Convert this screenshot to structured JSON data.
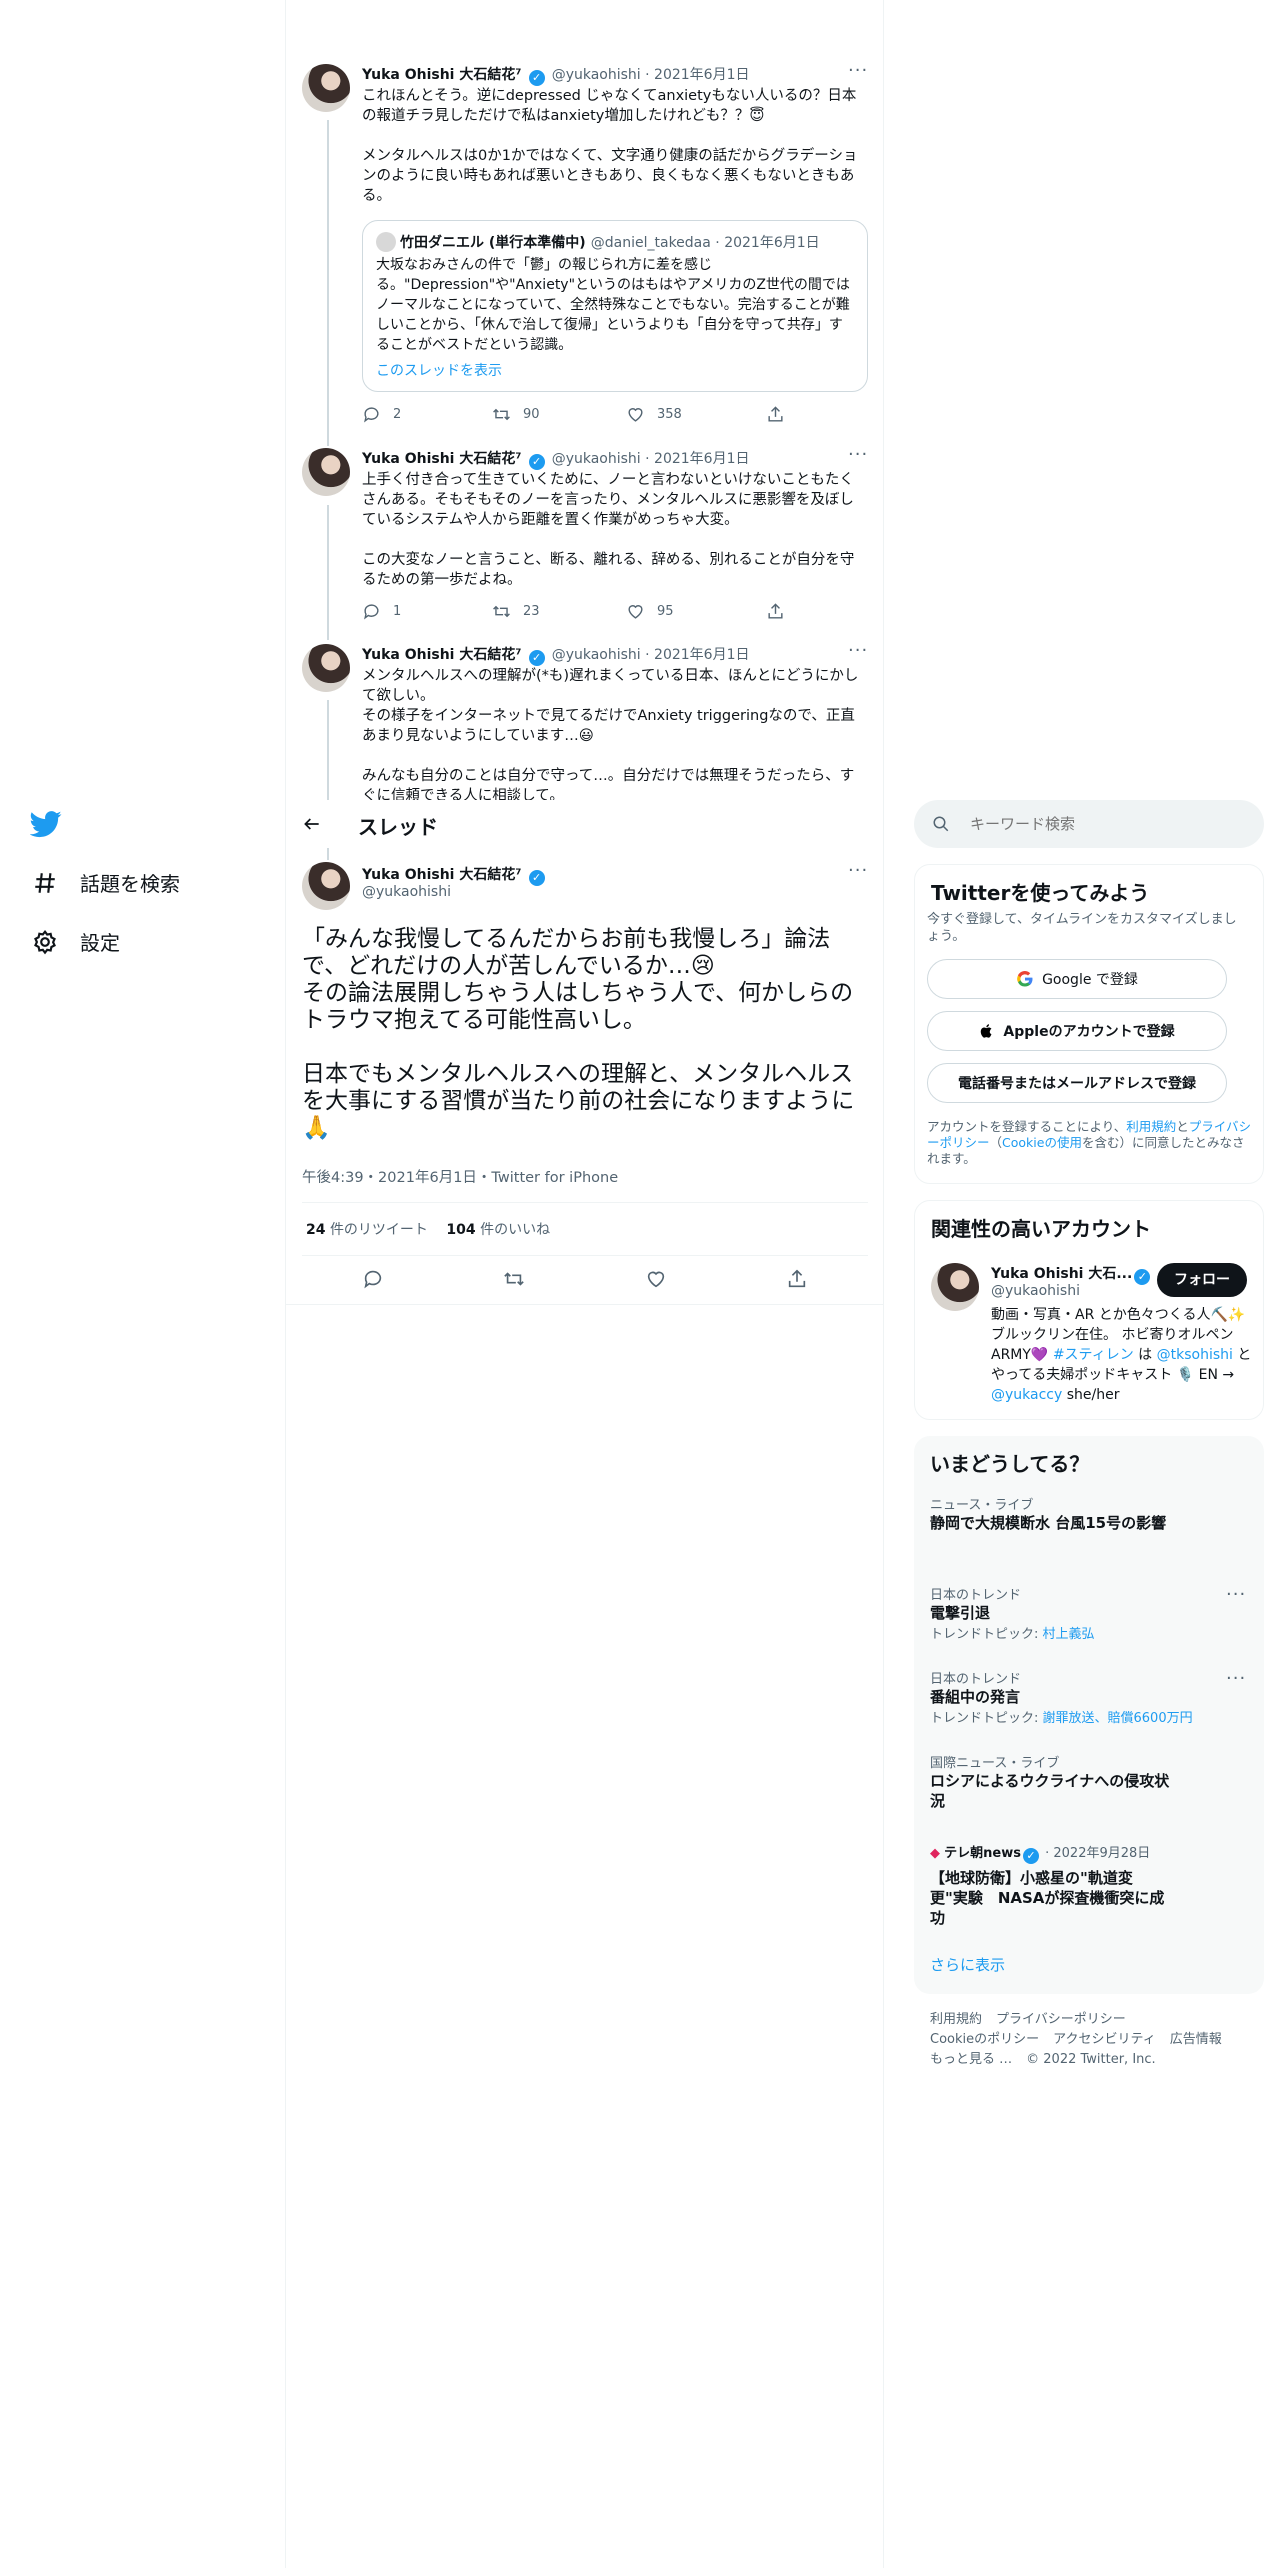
{
  "sidebar": {
    "items": [
      {
        "label": "話題を検索",
        "icon": "hashtag-icon"
      },
      {
        "label": "設定",
        "icon": "gear-icon"
      }
    ],
    "logo": "twitter-bird-icon"
  },
  "header": {
    "title": "スレッド"
  },
  "search": {
    "placeholder": "キーワード検索"
  },
  "tweets": [
    {
      "name": "Yuka Ohishi 大石結花",
      "badge": "⁷",
      "handle": "@yukaohishi",
      "date": "2021年6月1日",
      "text": "これほんとそう。逆にdepressed じゃなくてanxietyもない人いるの？日本の報道チラ見しただけで私はanxiety増加したけれども？？😇\n\nメンタルヘルスは0か1かではなくて、文字通り健康の話だからグラデーションのように良い時もあれば悪いときもあり、良くもなく悪くもないときもある。",
      "quote": {
        "name": "竹田ダニエル (単行本準備中)",
        "handle": "@daniel_takedaa",
        "date": "2021年6月1日",
        "text": "大坂なおみさんの件で「鬱」の報じられ方に差を感じる。\"Depression\"や\"Anxiety\"というのはもはやアメリカのZ世代の間ではノーマルなことになっていて、全然特殊なことでもない。完治することが難しいことから、「休んで治して復帰」というよりも「自分を守って共存」することがベストだという認識。",
        "show_thread": "このスレッドを表示"
      },
      "replies": "2",
      "retweets": "90",
      "likes": "358"
    },
    {
      "name": "Yuka Ohishi 大石結花",
      "badge": "⁷",
      "handle": "@yukaohishi",
      "date": "2021年6月1日",
      "text": "上手く付き合って生きていくために、ノーと言わないといけないこともたくさんある。そもそもそのノーを言ったり、メンタルヘルスに悪影響を及ぼしているシステムや人から距離を置く作業がめっちゃ大変。\n\nこの大変なノーと言うこと、断る、離れる、辞める、別れることが自分を守るための第一歩だよね。",
      "replies": "1",
      "retweets": "23",
      "likes": "95"
    },
    {
      "name": "Yuka Ohishi 大石結花",
      "badge": "⁷",
      "handle": "@yukaohishi",
      "date": "2021年6月1日",
      "text": "メンタルヘルスへの理解が(*も)遅れまくっている日本、ほんとにどうにかして欲しい。\nその様子をインターネットで見てるだけでAnxiety triggeringなので、正直あまり見ないようにしています…😃\n\nみんなも自分のことは自分で守って…。自分だけでは無理そうだったら、すぐに信頼できる人に相談して。"
    }
  ],
  "main_tweet": {
    "name": "Yuka Ohishi 大石結花",
    "badge": "⁷",
    "handle": "@yukaohishi",
    "text": "「みんな我慢してるんだからお前も我慢しろ」論法で、どれだけの人が苦しんでいるか…😢\nその論法展開しちゃう人はしちゃう人で、何かしらのトラウマ抱えてる可能性高いし。\n\n日本でもメンタルヘルスへの理解と、メンタルヘルスを大事にする習慣が当たり前の社会になりますように🙏",
    "timestamp": "午後4:39・2021年6月1日・Twitter for iPhone",
    "retweet_count": "24",
    "retweet_label": "件のリツイート",
    "like_count": "104",
    "like_label": "件のいいね"
  },
  "signup": {
    "title": "Twitterを使ってみよう",
    "subtitle": "今すぐ登録して、タイムラインをカスタマイズしましょう。",
    "google": "Google で登録",
    "apple": "Appleのアカウントで登録",
    "phone": "電話番号またはメールアドレスで登録",
    "terms_prefix": "アカウントを登録することにより、",
    "terms_link1": "利用規約",
    "terms_and": "と",
    "terms_link2": "プライバシーポリシー",
    "terms_paren_open": "（",
    "terms_link3": "Cookieの使用",
    "terms_suffix": "を含む）に同意したとみなされます。"
  },
  "related": {
    "title": "関連性の高いアカウント",
    "name": "Yuka Ohishi 大石...",
    "handle": "@yukaohishi",
    "follow": "フォロー",
    "bio_1": "動画・写真・AR とか色々つくる人⛏️✨ ブルックリン在住。 ホビ寄りオルペンARMY💜 ",
    "bio_hashtag": "#スティレン",
    "bio_2": " は ",
    "bio_mention1": "@tksohishi",
    "bio_3": " とやってる夫婦ポッドキャスト 🎙️ EN → ",
    "bio_mention2": "@yukaccy",
    "bio_4": " she/her"
  },
  "trends": {
    "title": "いまどうしてる？",
    "items": [
      {
        "category": "ニュース・ライブ",
        "title": "静岡で大規模断水 台風15号の影響"
      },
      {
        "category": "日本のトレンド",
        "title": "電撃引退",
        "topic_label": "トレンドトピック: ",
        "topic": "村上義弘"
      },
      {
        "category": "日本のトレンド",
        "title": "番組中の発言",
        "topic_label": "トレンドトピック: ",
        "topic": "謝罪放送、賠償6600万円"
      },
      {
        "category": "国際ニュース・ライブ",
        "title": "ロシアによるウクライナへの侵攻状況"
      },
      {
        "source": "テレ朝news",
        "date": "2022年9月28日",
        "title": "【地球防衛】小惑星の\"軌道変更\"実験　NASAが探査機衝突に成功"
      }
    ],
    "show_more": "さらに表示"
  },
  "footer": {
    "links_row1": [
      "利用規約",
      "プライバシーポリシー"
    ],
    "links_row2": [
      "Cookieのポリシー",
      "アクセシビリティ",
      "広告情報"
    ],
    "more": "もっと見る …",
    "copyright": "© 2022 Twitter, Inc."
  }
}
